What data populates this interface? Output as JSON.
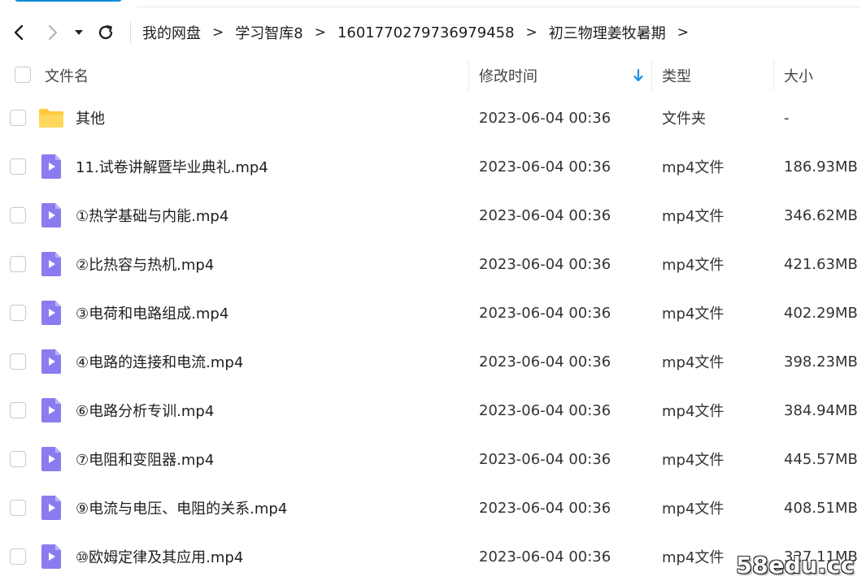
{
  "navigation": {
    "back_icon": "back-arrow-icon",
    "forward_icon": "forward-arrow-icon",
    "history_icon": "history-dropdown-icon",
    "refresh_icon": "refresh-icon"
  },
  "breadcrumb": [
    {
      "label": "我的网盘"
    },
    {
      "label": "学习智库8"
    },
    {
      "label": "1601770279736979458"
    },
    {
      "label": "初三物理姜牧暑期"
    }
  ],
  "breadcrumb_separator": ">",
  "columns": {
    "name": "文件名",
    "modified": "修改时间",
    "type": "类型",
    "size": "大小",
    "sort_icon": "sort-down-arrow-icon"
  },
  "files": [
    {
      "name": "其他",
      "modified": "2023-06-04 00:36",
      "type": "文件夹",
      "size": "-",
      "icon": "folder-icon"
    },
    {
      "name": "11.试卷讲解暨毕业典礼.mp4",
      "modified": "2023-06-04 00:36",
      "type": "mp4文件",
      "size": "186.93MB",
      "icon": "video-file-icon"
    },
    {
      "name": "①热学基础与内能.mp4",
      "modified": "2023-06-04 00:36",
      "type": "mp4文件",
      "size": "346.62MB",
      "icon": "video-file-icon"
    },
    {
      "name": "②比热容与热机.mp4",
      "modified": "2023-06-04 00:36",
      "type": "mp4文件",
      "size": "421.63MB",
      "icon": "video-file-icon"
    },
    {
      "name": "③电荷和电路组成.mp4",
      "modified": "2023-06-04 00:36",
      "type": "mp4文件",
      "size": "402.29MB",
      "icon": "video-file-icon"
    },
    {
      "name": "④电路的连接和电流.mp4",
      "modified": "2023-06-04 00:36",
      "type": "mp4文件",
      "size": "398.23MB",
      "icon": "video-file-icon"
    },
    {
      "name": "⑥电路分析专训.mp4",
      "modified": "2023-06-04 00:36",
      "type": "mp4文件",
      "size": "384.94MB",
      "icon": "video-file-icon"
    },
    {
      "name": "⑦电阻和变阻器.mp4",
      "modified": "2023-06-04 00:36",
      "type": "mp4文件",
      "size": "445.57MB",
      "icon": "video-file-icon"
    },
    {
      "name": "⑨电流与电压、电阻的关系.mp4",
      "modified": "2023-06-04 00:36",
      "type": "mp4文件",
      "size": "408.51MB",
      "icon": "video-file-icon"
    },
    {
      "name": "⑩欧姆定律及其应用.mp4",
      "modified": "2023-06-04 00:36",
      "type": "mp4文件",
      "size": "327.11MB",
      "icon": "video-file-icon"
    }
  ],
  "watermark": "58edu.cc",
  "colors": {
    "accent": "#0d8bd6",
    "folder": "#ffc93c",
    "video": "#8a7cf0"
  }
}
